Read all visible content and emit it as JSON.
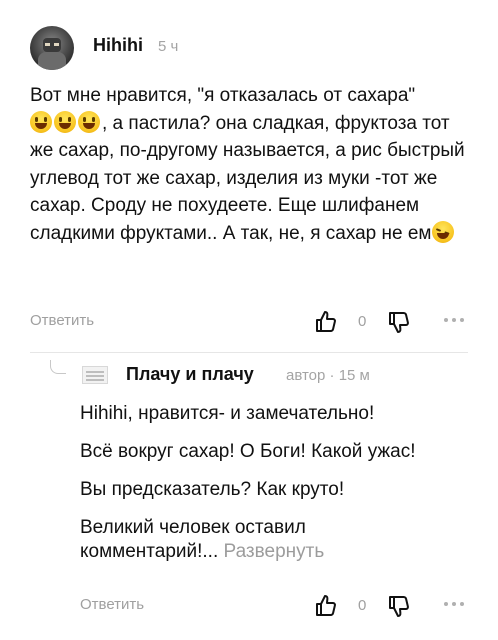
{
  "comment": {
    "author": "Hihihi",
    "time": "5 ч",
    "text_line1": "Вот мне нравится, \"я отказалась от сахара\"",
    "text_line2_rest": ", а пастила? она сладкая, фруктоза",
    "text_rest": "тот же сахар, по-другому называется, а рис быстрый углевод тот же сахар, изделия из муки -тот же сахар. Сроду не похудеете. Еще шлифанем сладкими фруктами.. А так, не, я сахар не ем",
    "reply_label": "Ответить",
    "like_count": "0"
  },
  "reply": {
    "author": "Плачу и плачу",
    "meta": "автор · 15 м",
    "lines": [
      "Hihihi, нравится- и замечательно!",
      "Всё вокруг сахар! О Боги! Какой ужас!",
      "Вы предсказатель? Как круто!",
      "Великий человек оставил комментарий!..."
    ],
    "expand_label": "Развернуть",
    "reply_label": "Ответить",
    "like_count": "0"
  },
  "icons": {
    "like": "thumb-up-icon",
    "dislike": "thumb-down-icon",
    "more": "more-dots-icon",
    "emoji": "grinning-face-emoji",
    "emoji_laugh": "laughing-squint-emoji"
  },
  "colors": {
    "text": "#111111",
    "muted": "#a0a0a0",
    "emoji": "#f7c21e"
  }
}
